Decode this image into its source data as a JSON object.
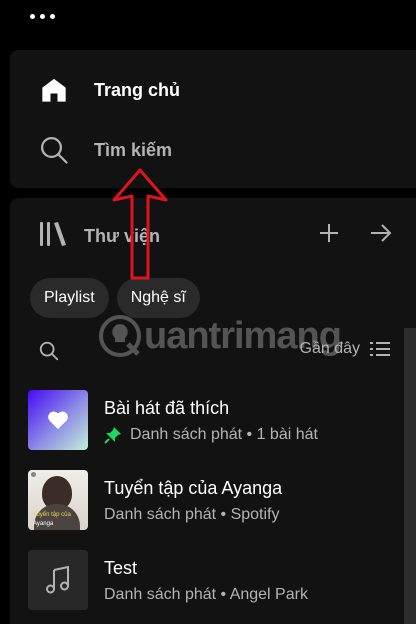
{
  "menu": {
    "icon": "more-dots-icon"
  },
  "nav": {
    "home_label": "Trang chủ",
    "search_label": "Tìm kiếm"
  },
  "library": {
    "title": "Thư viện",
    "filters": [
      "Playlist",
      "Nghệ sĩ"
    ],
    "sort_label": "Gần đây",
    "items": [
      {
        "title": "Bài hát đã thích",
        "subtitle": "Danh sách phát • 1 bài hát",
        "pinned": true,
        "thumb": "heart-icon"
      },
      {
        "title": "Tuyển tập của Ayanga",
        "subtitle": "Danh sách phát • Spotify",
        "pinned": false,
        "thumb_caption_1": "Tuyển tập của",
        "thumb_caption_2": "Ayanga"
      },
      {
        "title": "Test",
        "subtitle": "Danh sách phát • Angel Park",
        "pinned": false,
        "thumb": "music-note-icon"
      }
    ]
  },
  "watermark": {
    "text": "uantrimang"
  },
  "colors": {
    "background": "#000000",
    "panel": "#121212",
    "chip": "#2a2a2a",
    "text_primary": "#ffffff",
    "text_secondary": "#b3b3b3",
    "pin_green": "#1ed760",
    "annotation_red": "#e0141e"
  }
}
